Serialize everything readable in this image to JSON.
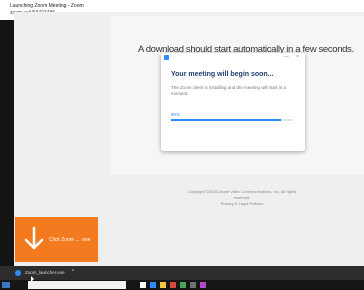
{
  "browser": {
    "tab_title": "Launching Zoom Meeting - Zoom",
    "url": "zoom.us/j/93427486"
  },
  "page": {
    "download_message": "A download should start automatically in a few seconds.",
    "copyright": "Copyright ©2020 Zoom Video Communications, Inc. All rights reserved.",
    "legal_link": "Privacy & Legal Policies"
  },
  "modal": {
    "heading": "Your meeting will begin soon...",
    "subtext": "The Zoom client is installing and the meeting will start in a moment.",
    "progress_label": "90%",
    "progress_value": 0.9,
    "buttons": "—  ×"
  },
  "download_prompt": {
    "text": "Click Zoom ... .exe",
    "color": "#f47a1f"
  },
  "download_bar": {
    "item_name": "Zoom_launcher.exe",
    "chevron": "^"
  },
  "colors": {
    "zoom_blue": "#2d8cff",
    "prompt_orange": "#f47a1f"
  }
}
